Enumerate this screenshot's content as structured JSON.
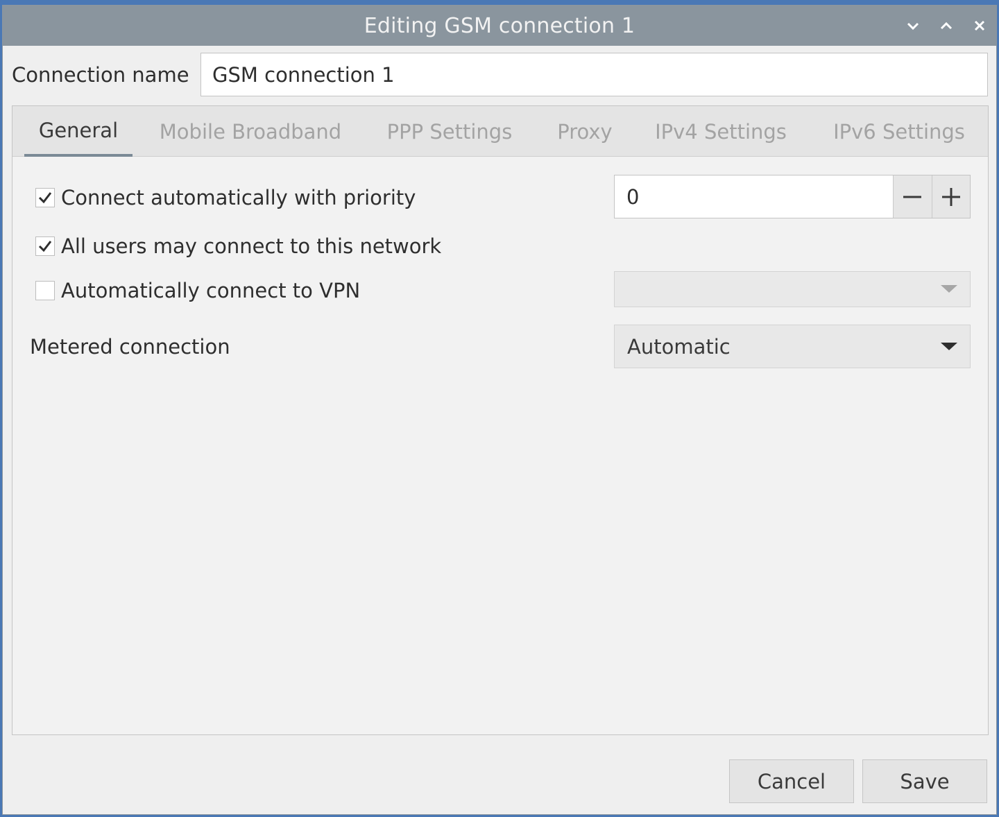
{
  "window": {
    "title": "Editing GSM connection 1"
  },
  "connection": {
    "name_label": "Connection name",
    "name_value": "GSM connection 1"
  },
  "tabs": [
    {
      "label": "General",
      "active": true
    },
    {
      "label": "Mobile Broadband",
      "active": false
    },
    {
      "label": "PPP Settings",
      "active": false
    },
    {
      "label": "Proxy",
      "active": false
    },
    {
      "label": "IPv4 Settings",
      "active": false
    },
    {
      "label": "IPv6 Settings",
      "active": false
    }
  ],
  "general": {
    "auto_connect": {
      "label": "Connect automatically with priority",
      "checked": true
    },
    "priority_value": "0",
    "all_users": {
      "label": "All users may connect to this network",
      "checked": true
    },
    "auto_vpn": {
      "label": "Automatically connect to VPN",
      "checked": false
    },
    "vpn_selected": "",
    "metered": {
      "label": "Metered connection",
      "selected": "Automatic"
    }
  },
  "buttons": {
    "cancel": "Cancel",
    "save": "Save"
  }
}
